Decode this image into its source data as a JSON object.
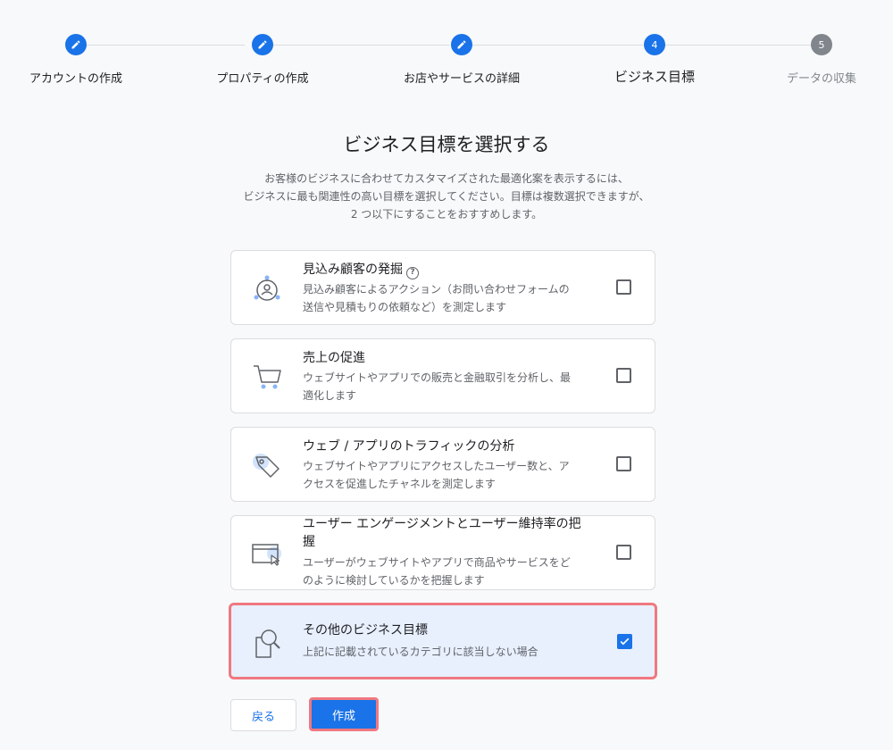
{
  "stepper": {
    "steps": [
      {
        "number": "",
        "label": "アカウントの作成",
        "state": "done"
      },
      {
        "number": "",
        "label": "プロパティの作成",
        "state": "done"
      },
      {
        "number": "",
        "label": "お店やサービスの詳細",
        "state": "done"
      },
      {
        "number": "4",
        "label": "ビジネス目標",
        "state": "current"
      },
      {
        "number": "5",
        "label": "データの収集",
        "state": "pending"
      }
    ]
  },
  "heading": {
    "title": "ビジネス目標を選択する",
    "description_lines": [
      "お客様のビジネスに合わせてカスタマイズされた最適化案を表示するには、",
      "ビジネスに最も関連性の高い目標を選択してください。目標は複数選択できますが、",
      "2 つ以下にすることをおすすめします。"
    ]
  },
  "options": [
    {
      "title": "見込み顧客の発掘",
      "desc_lines": [
        "見込み顧客によるアクション（お問い合わせフォームの",
        "送信や見積もりの依頼など）を測定します"
      ],
      "icon": "lead-target-icon",
      "checked": false,
      "has_help": true
    },
    {
      "title": "売上の促進",
      "desc_lines": [
        "ウェブサイトやアプリでの販売と金融取引を分析し、最",
        "適化します"
      ],
      "icon": "shopping-cart-icon",
      "checked": false
    },
    {
      "title": "ウェブ / アプリのトラフィックの分析",
      "desc_lines": [
        "ウェブサイトやアプリにアクセスしたユーザー数と、ア",
        "クセスを促進したチャネルを測定します"
      ],
      "icon": "tag-icon",
      "checked": false
    },
    {
      "title_lines": [
        "ユーザー エンゲージメントとユーザー維持率の把",
        "握"
      ],
      "desc_lines": [
        "ユーザーがウェブサイトやアプリで商品やサービスをど",
        "のように検討しているかを把握します"
      ],
      "icon": "browser-cursor-icon",
      "checked": false
    },
    {
      "title": "その他のビジネス目標",
      "desc_lines": [
        "上記に記載されているカテゴリに該当しない場合"
      ],
      "icon": "magnifier-document-icon",
      "checked": true
    }
  ],
  "buttons": {
    "back_label": "戻る",
    "create_label": "作成"
  },
  "colors": {
    "accent": "#1a73e8",
    "highlight_border": "#f07880",
    "selected_bg": "#e8f0fe"
  }
}
